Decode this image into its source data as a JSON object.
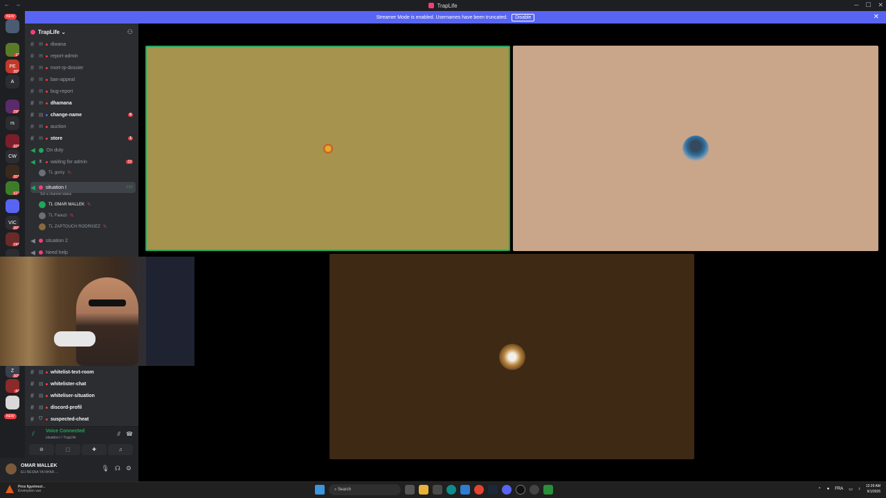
{
  "window": {
    "title": "TrapLife",
    "controls": [
      "─",
      "☐",
      "✕"
    ],
    "left_icons": [
      "←",
      "→"
    ]
  },
  "banner": {
    "text": "Streamer Mode is enabled. Usernames have been truncated.",
    "button": "Disable",
    "close": "✕"
  },
  "rail": {
    "new_top": "NEW",
    "new_bottom": "NEW",
    "servers": [
      {
        "label": "",
        "badge": "",
        "color": "#4a5b73"
      },
      {
        "label": "",
        "badge": "23",
        "color": "#5a7a2a"
      },
      {
        "label": "PE",
        "badge": "209",
        "color": "#c0392b"
      },
      {
        "label": "A",
        "badge": "",
        "color": "#2b2d31"
      },
      {
        "label": "",
        "badge": "290",
        "color": "#5b2a6b"
      },
      {
        "label": "rs",
        "badge": "",
        "color": "#2b2d31"
      },
      {
        "label": "",
        "badge": "374",
        "color": "#7a1f2a"
      },
      {
        "label": "CW",
        "badge": "",
        "color": "#2b2d31"
      },
      {
        "label": "",
        "badge": "201",
        "color": "#3a2a1e"
      },
      {
        "label": "",
        "badge": "622",
        "color": "#3d7d2a"
      },
      {
        "label": "",
        "badge": "",
        "color": "#5865f2"
      },
      {
        "label": "VIC",
        "badge": "309",
        "color": "#2b2d31"
      },
      {
        "label": "",
        "badge": "741",
        "color": "#6b2a2a"
      },
      {
        "label": "",
        "badge": "",
        "color": "#2b2d31"
      },
      {
        "label": "Z",
        "badge": "305",
        "color": "#3a3f4a"
      },
      {
        "label": "",
        "badge": "64",
        "color": "#8a2a2a"
      },
      {
        "label": "",
        "badge": "",
        "color": "#d8d8d8"
      }
    ]
  },
  "guild": {
    "name": "TrapLife ⌄"
  },
  "channels": [
    {
      "name": "diwana",
      "bold": false
    },
    {
      "name": "report-admin",
      "bold": false
    },
    {
      "name": "mort-rp-dossier",
      "bold": false
    },
    {
      "name": "ban-appeal",
      "bold": false
    },
    {
      "name": "bug-report",
      "bold": false
    },
    {
      "name": "dhamana",
      "bold": true
    },
    {
      "name": "change-name",
      "bold": true,
      "count": "6"
    },
    {
      "name": "auction",
      "bold": false
    },
    {
      "name": "store",
      "bold": true,
      "count": "1"
    },
    {
      "name": "On duty",
      "bold": false
    },
    {
      "name": "waiting for admin",
      "bold": false,
      "count": "13"
    }
  ],
  "voice_waiting_user": {
    "prefix": "TL",
    "name": "gomy",
    "tag": "TL"
  },
  "active_voice": {
    "name": "situation I",
    "time": "2:51",
    "status": "Set a channel status"
  },
  "voice_members": [
    {
      "prefix": "TL",
      "name": "OMAR MALLEK",
      "tag": "TL"
    },
    {
      "prefix": "TL",
      "name": "Faouzi",
      "tag": "TL"
    },
    {
      "prefix": "TL",
      "name": "ZAPTOUCH RODRIGEZ",
      "tag": "TL"
    }
  ],
  "more_voice": [
    {
      "name": "situation 2"
    },
    {
      "name": "Need help"
    }
  ],
  "bottom_channels": [
    {
      "name": "whitelist-text-room"
    },
    {
      "name": "whitelister-chat"
    },
    {
      "name": "whiteliser-situation"
    },
    {
      "name": "discord-profil"
    },
    {
      "name": "suspected-cheat"
    }
  ],
  "voice_panel": {
    "title": "Voice Connected",
    "sub": "situation I / TrapLife"
  },
  "user": {
    "name": "OMAR MALLEK",
    "status": "ELI BESNA YA NHAR ..."
  },
  "taskbar": {
    "notif_title": "Piros figyelmezt...",
    "notif_sub": "Érvényben van",
    "search": "Search",
    "lang": "FRA",
    "time": "12:29 AM",
    "date": "9/1/2026"
  }
}
